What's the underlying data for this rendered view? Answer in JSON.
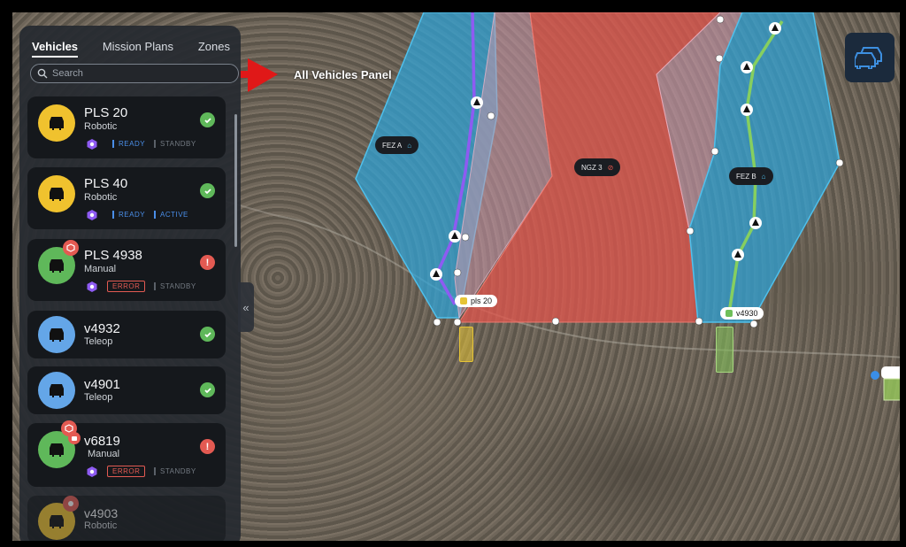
{
  "sidebar": {
    "tabs": [
      {
        "label": "Vehicles",
        "active": true
      },
      {
        "label": "Mission Plans",
        "active": false
      },
      {
        "label": "Zones",
        "active": false
      }
    ],
    "search_placeholder": "Search",
    "vehicles": [
      {
        "name": "PLS 20",
        "type": "Robotic",
        "avatar_color": "#f0c22e",
        "status": "ok",
        "states": [
          "READY",
          "STANDBY"
        ]
      },
      {
        "name": "PLS 40",
        "type": "Robotic",
        "avatar_color": "#f0c22e",
        "status": "ok",
        "states": [
          "READY",
          "ACTIVE"
        ]
      },
      {
        "name": "PLS 4938",
        "type": "Manual",
        "avatar_color": "#5fb85a",
        "status": "alert",
        "states": [
          "ERROR",
          "STANDBY"
        ]
      },
      {
        "name": "v4932",
        "type": "Teleop",
        "avatar_color": "#64a6e8",
        "status": "ok",
        "states": []
      },
      {
        "name": "v4901",
        "type": "Teleop",
        "avatar_color": "#64a6e8",
        "status": "ok",
        "states": []
      },
      {
        "name": "v6819",
        "type": "Manual",
        "avatar_color": "#5fb85a",
        "status": "alert",
        "states": [
          "ERROR",
          "STANDBY"
        ]
      },
      {
        "name": "v4903",
        "type": "Robotic",
        "avatar_color": "#f0c22e",
        "status": "none",
        "states": []
      }
    ],
    "alert_glyph": "!"
  },
  "annotation": {
    "label": "All Vehicles Panel"
  },
  "map": {
    "zones": [
      {
        "label": "FEZ A",
        "color": "#2ea3d8"
      },
      {
        "label": "NGZ 3",
        "color": "#e2554c"
      },
      {
        "label": "FEZ B",
        "color": "#2ea3d8"
      }
    ],
    "vehicle_labels": [
      {
        "label": "pls 20",
        "color": "#e6c436"
      },
      {
        "label": "v4930",
        "color": "#6fbf5a"
      }
    ]
  },
  "colors": {
    "accent_blue": "#4a8ee8",
    "error_red": "#e35a52",
    "ok_green": "#5fb85a",
    "route_purple": "#8e5bf2",
    "route_green": "#86cf5f"
  },
  "icons": {
    "fleet": "fleet-vehicles-icon",
    "collapse": "collapse-left-icon",
    "search": "search-icon"
  }
}
